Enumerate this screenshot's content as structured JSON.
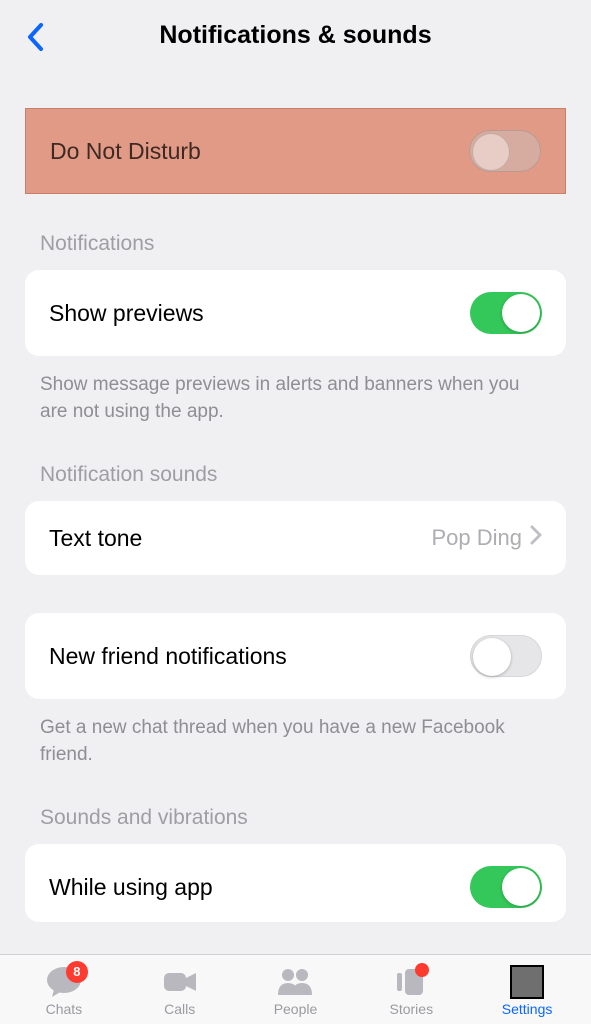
{
  "header": {
    "title": "Notifications & sounds"
  },
  "dnd": {
    "label": "Do Not Disturb",
    "on": false
  },
  "sections": {
    "notifications": {
      "header": "Notifications",
      "show_previews_label": "Show previews",
      "show_previews_on": true,
      "footer": "Show message previews in alerts and banners when you are not using the app."
    },
    "notification_sounds": {
      "header": "Notification sounds",
      "text_tone_label": "Text tone",
      "text_tone_value": "Pop Ding"
    },
    "new_friend": {
      "label": "New friend notifications",
      "on": false,
      "footer": "Get a new chat thread when you have a new Facebook friend."
    },
    "sounds_vibrations": {
      "header": "Sounds and vibrations",
      "while_using_label": "While using app",
      "while_using_on": true
    }
  },
  "tabs": {
    "chats": {
      "label": "Chats",
      "badge": "8"
    },
    "calls": {
      "label": "Calls"
    },
    "people": {
      "label": "People"
    },
    "stories": {
      "label": "Stories"
    },
    "settings": {
      "label": "Settings"
    }
  }
}
